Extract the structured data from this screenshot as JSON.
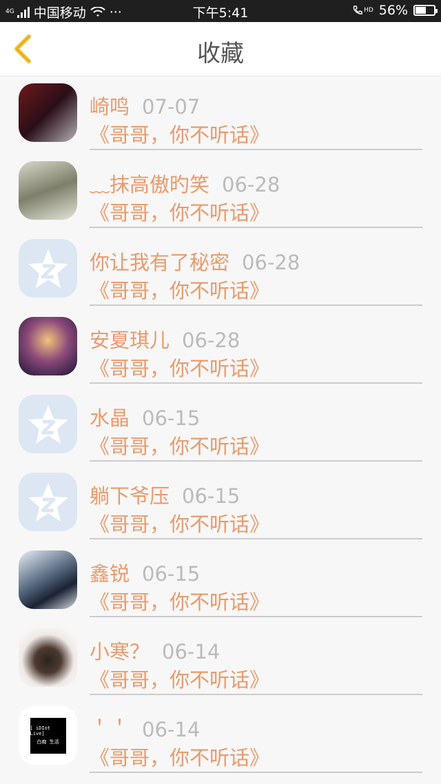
{
  "status_bar": {
    "network": "4G",
    "carrier": "中国移动",
    "more": "···",
    "time": "下午5:41",
    "hd": "HD",
    "battery_percent": "56%",
    "battery_level": 0.56
  },
  "header": {
    "title": "收藏"
  },
  "items": [
    {
      "name": "崎鸣",
      "date": "07-07",
      "text": "《哥哥，你不听话》",
      "avatar": "photo"
    },
    {
      "name": "﹏抹高傲旳笑",
      "date": "06-28",
      "text": "《哥哥，你不听话》",
      "avatar": "photo"
    },
    {
      "name": "你让我有了秘密",
      "date": "06-28",
      "text": "《哥哥，你不听话》",
      "avatar": "qq-default"
    },
    {
      "name": "安夏琪儿",
      "date": "06-28",
      "text": "《哥哥，你不听话》",
      "avatar": "photo"
    },
    {
      "name": "水晶",
      "date": "06-15",
      "text": "《哥哥，你不听话》",
      "avatar": "qq-default"
    },
    {
      "name": "躺下爷压",
      "date": "06-15",
      "text": "《哥哥，你不听话》",
      "avatar": "qq-default"
    },
    {
      "name": "鑫锐",
      "date": "06-15",
      "text": "《哥哥，你不听话》",
      "avatar": "photo"
    },
    {
      "name": "小寒？",
      "date": "06-14",
      "text": "《哥哥，你不听话》",
      "avatar": "photo"
    },
    {
      "name": "＇＇",
      "date": "06-14",
      "text": "《哥哥，你不听话》",
      "avatar": "idiot-live"
    }
  ],
  "avatar_9_text": {
    "line1": "[ iDIot Live]",
    "line2": "白痴 生活"
  },
  "colors": {
    "accent": "#eb9a6b",
    "date": "#bbbbbb",
    "back_arrow": "#f2c02b",
    "title": "#555555"
  }
}
